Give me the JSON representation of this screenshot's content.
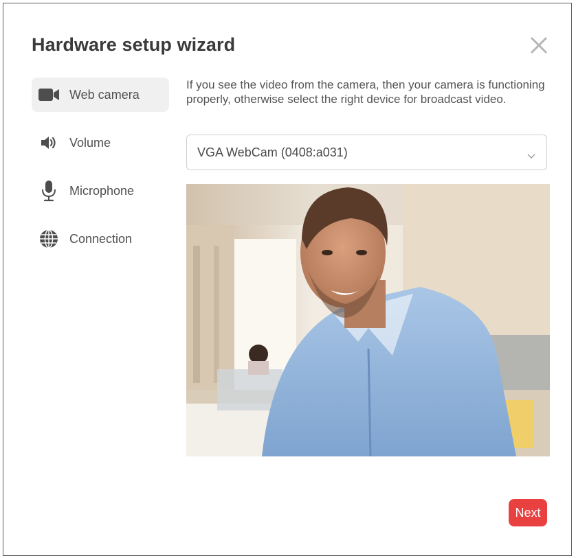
{
  "dialog": {
    "title": "Hardware setup wizard",
    "close_icon": "close-icon"
  },
  "sidebar": {
    "items": [
      {
        "label": "Web camera",
        "icon": "video-camera-icon",
        "active": true
      },
      {
        "label": "Volume",
        "icon": "speaker-icon",
        "active": false
      },
      {
        "label": "Microphone",
        "icon": "microphone-icon",
        "active": false
      },
      {
        "label": "Connection",
        "icon": "globe-icon",
        "active": false
      }
    ]
  },
  "main": {
    "description": "If you see the video from the camera, then your camera is functioning properly, otherwise select the right device for broadcast video.",
    "device_select": {
      "value": "VGA WebCam (0408:a031)",
      "icon": "chevron-down-icon"
    }
  },
  "footer": {
    "next_label": "Next"
  },
  "colors": {
    "accent": "#e94040",
    "active_nav_bg": "#f0f0f1",
    "text": "#505050"
  }
}
